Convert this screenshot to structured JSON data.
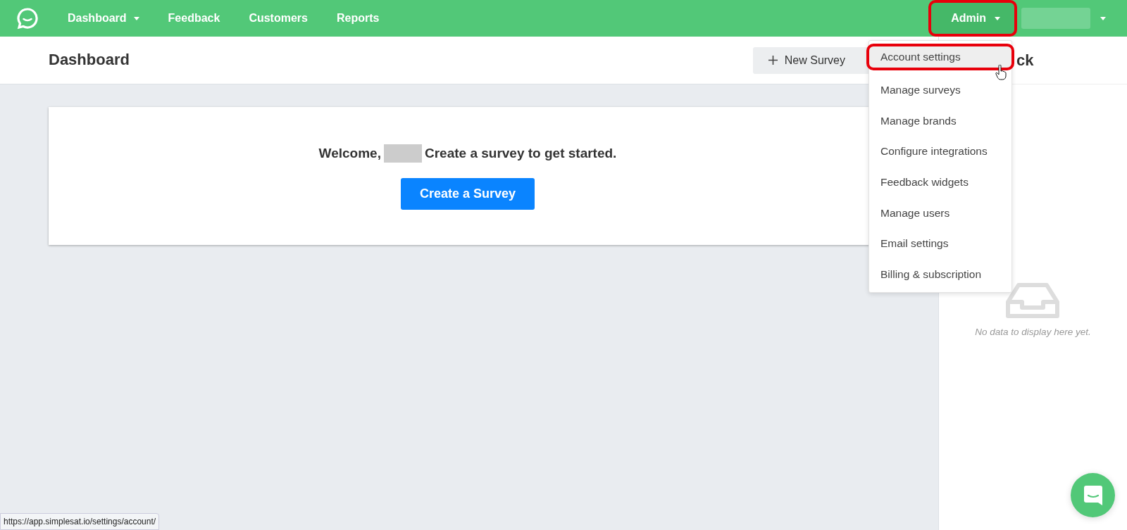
{
  "navbar": {
    "items": [
      {
        "label": "Dashboard",
        "has_caret": true,
        "selected": false
      },
      {
        "label": "Feedback",
        "has_caret": false,
        "selected": false
      },
      {
        "label": "Customers",
        "has_caret": false,
        "selected": false
      },
      {
        "label": "Reports",
        "has_caret": false,
        "selected": false
      }
    ],
    "admin_menu": {
      "label": "Admin",
      "expanded": true,
      "highlighted": true
    },
    "user_menu": {
      "redacted": true
    }
  },
  "header": {
    "title": "Dashboard",
    "new_survey_button": "New Survey"
  },
  "welcome_card": {
    "text_before": "Welcome,",
    "name_redacted": true,
    "text_after": "Create a survey to get started.",
    "button": "Create a Survey"
  },
  "admin_dropdown": [
    {
      "label": "Account settings",
      "selected": true,
      "highlighted": true
    },
    {
      "label": "Manage surveys",
      "selected": false,
      "highlighted": false
    },
    {
      "label": "Manage brands",
      "selected": false,
      "highlighted": false
    },
    {
      "label": "Configure integrations",
      "selected": false,
      "highlighted": false
    },
    {
      "label": "Feedback widgets",
      "selected": false,
      "highlighted": false
    },
    {
      "label": "Manage users",
      "selected": false,
      "highlighted": false
    },
    {
      "label": "Email settings",
      "selected": false,
      "highlighted": false
    },
    {
      "label": "Billing & subscription",
      "selected": false,
      "highlighted": false
    }
  ],
  "right_panel": {
    "title": "ck",
    "empty_message": "No data to display here yet."
  },
  "status_bar": {
    "url": "https://app.simplesat.io/settings/account/"
  }
}
